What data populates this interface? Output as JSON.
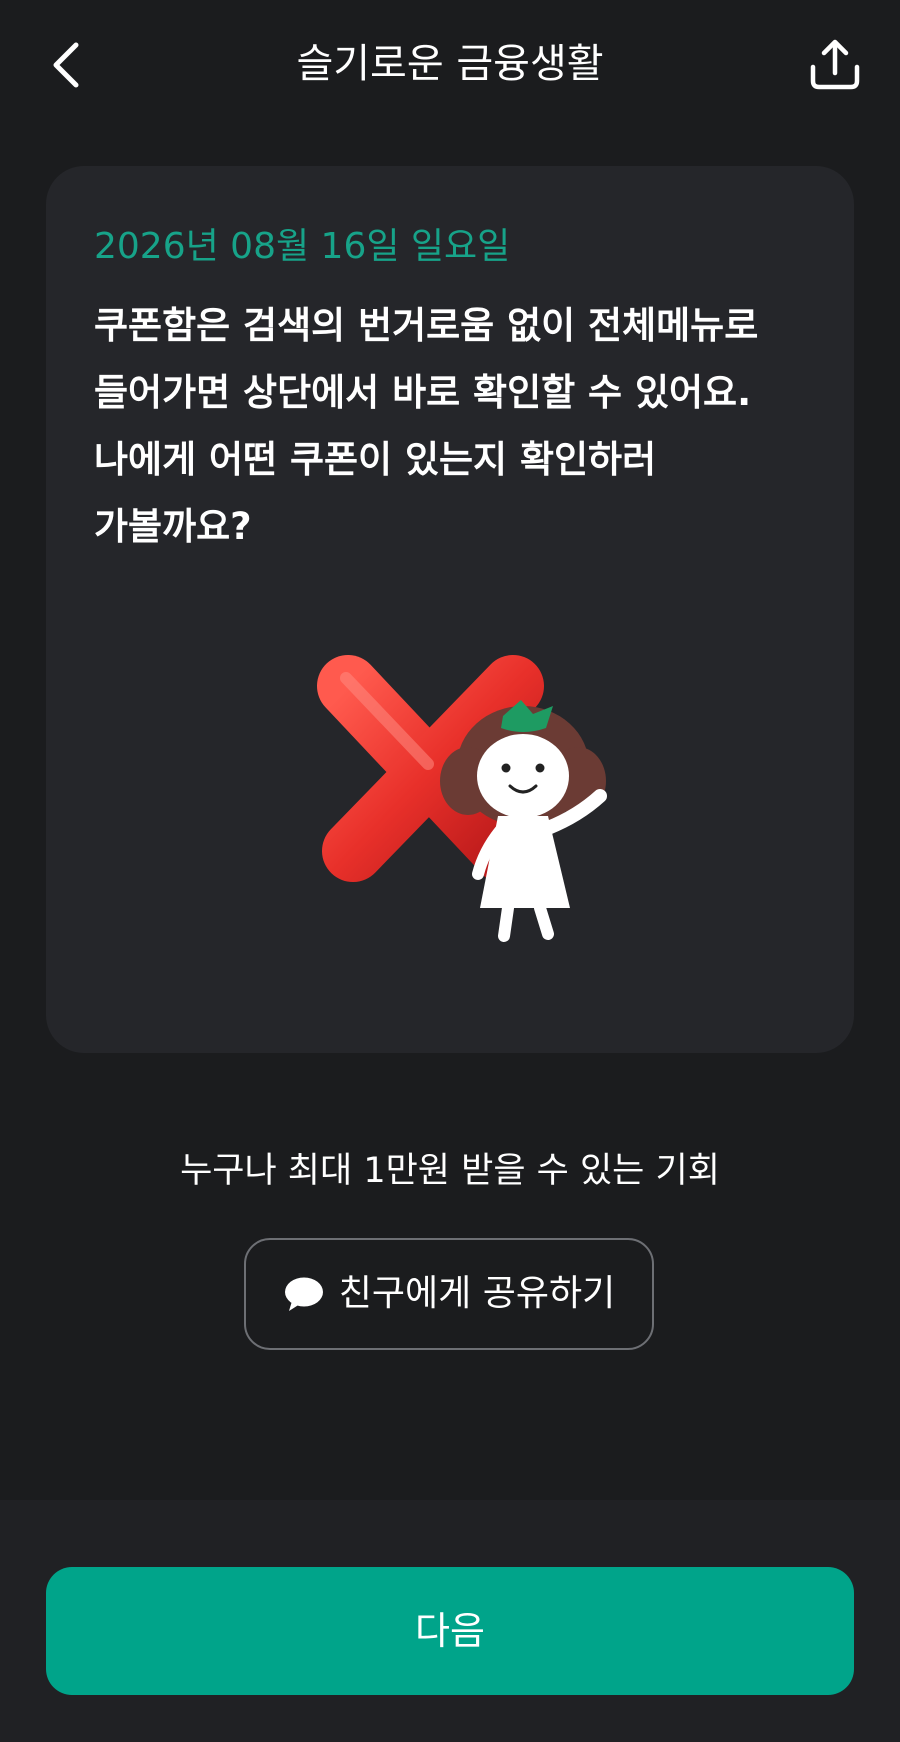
{
  "header": {
    "title": "슬기로운 금융생활",
    "back_icon": "chevron-left-icon",
    "share_icon": "share-upload-icon"
  },
  "card": {
    "date": "2026년 08월 16일 일요일",
    "message": "쿠폰함은 검색의 번거로움 없이 전체메뉴로\n들어가면 상단에서 바로 확인할 수 있어요.\n나에게 어떤 쿠폰이 있는지 확인하러\n가볼까요?",
    "illustration": "red-x-with-mascot"
  },
  "promo": {
    "text": "누구나 최대 1만원 받을 수 있는 기회",
    "share_button_label": "친구에게 공유하기",
    "share_button_icon": "speech-bubble-icon"
  },
  "footer": {
    "next_label": "다음"
  },
  "colors": {
    "background": "#1b1c1e",
    "card": "#25262a",
    "accent": "#00a48a",
    "date_text": "#17a389"
  }
}
